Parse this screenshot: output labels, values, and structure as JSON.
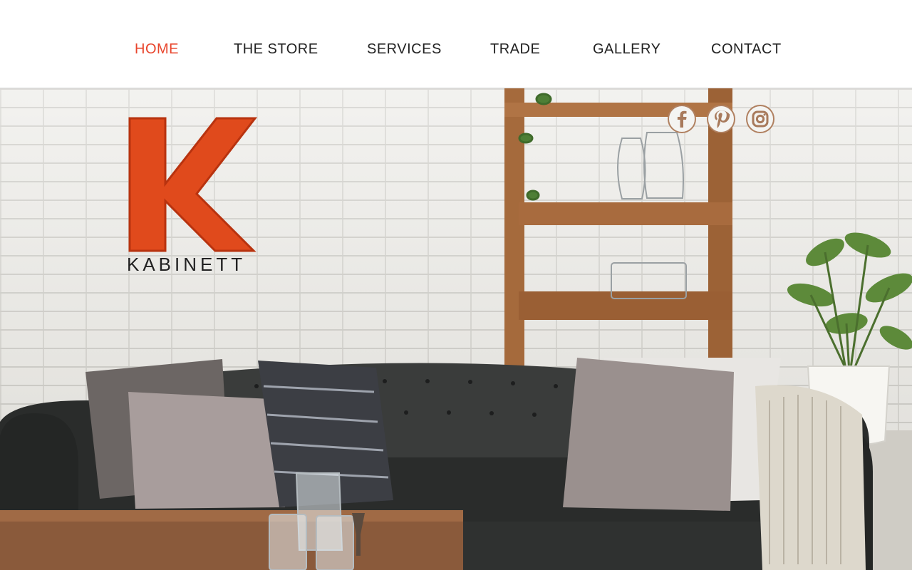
{
  "header": {
    "nav": [
      {
        "label": "HOME",
        "active": true
      },
      {
        "label": "THE STORE",
        "active": false
      },
      {
        "label": "SERVICES",
        "active": false
      },
      {
        "label": "TRADE",
        "active": false
      },
      {
        "label": "GALLERY",
        "active": false
      },
      {
        "label": "CONTACT",
        "active": false
      }
    ]
  },
  "hero": {
    "logo_text": "KABINETT",
    "logo_letter": "K",
    "social": [
      {
        "name": "Facebook",
        "icon": "facebook-icon"
      },
      {
        "name": "Pinterest",
        "icon": "pinterest-icon"
      },
      {
        "name": "Instagram",
        "icon": "instagram-icon"
      }
    ]
  },
  "colors": {
    "accent": "#e8452c",
    "nav_text": "#222222",
    "logo_orange": "#e04a1c",
    "social_icon": "#a87a5c"
  }
}
